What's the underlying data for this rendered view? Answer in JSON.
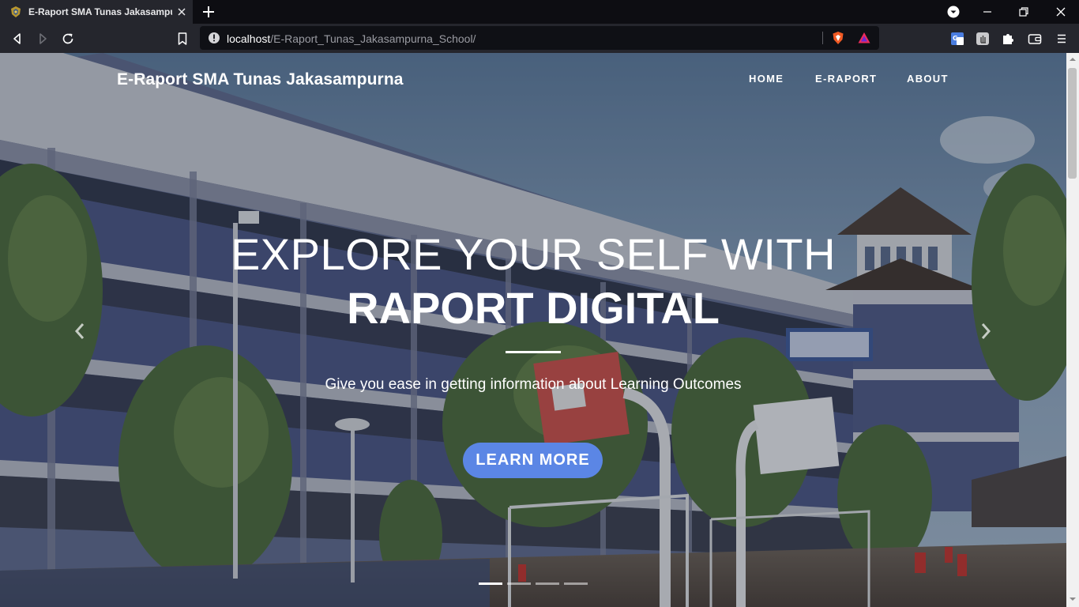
{
  "browser": {
    "tab": {
      "title": "E-Raport SMA Tunas Jakasampurna",
      "favicon": "school-emblem-icon"
    },
    "url": {
      "host": "localhost",
      "path": "/E-Raport_Tunas_Jakasampurna_School/"
    }
  },
  "navbar": {
    "brand": "E-Raport SMA Tunas Jakasampurna",
    "links": [
      "HOME",
      "E-RAPORT",
      "ABOUT"
    ]
  },
  "hero": {
    "line1": "EXPLORE YOUR SELF WITH",
    "line2": "RAPORT DIGITAL",
    "subtitle": "Give you ease in getting information about Learning Outcomes",
    "cta_label": "LEARN MORE",
    "slide_count": 4,
    "active_slide": 1
  },
  "colors": {
    "cta": "#5b86e5",
    "browser_chrome": "#25262d",
    "tab_strip": "#0d0d12"
  }
}
